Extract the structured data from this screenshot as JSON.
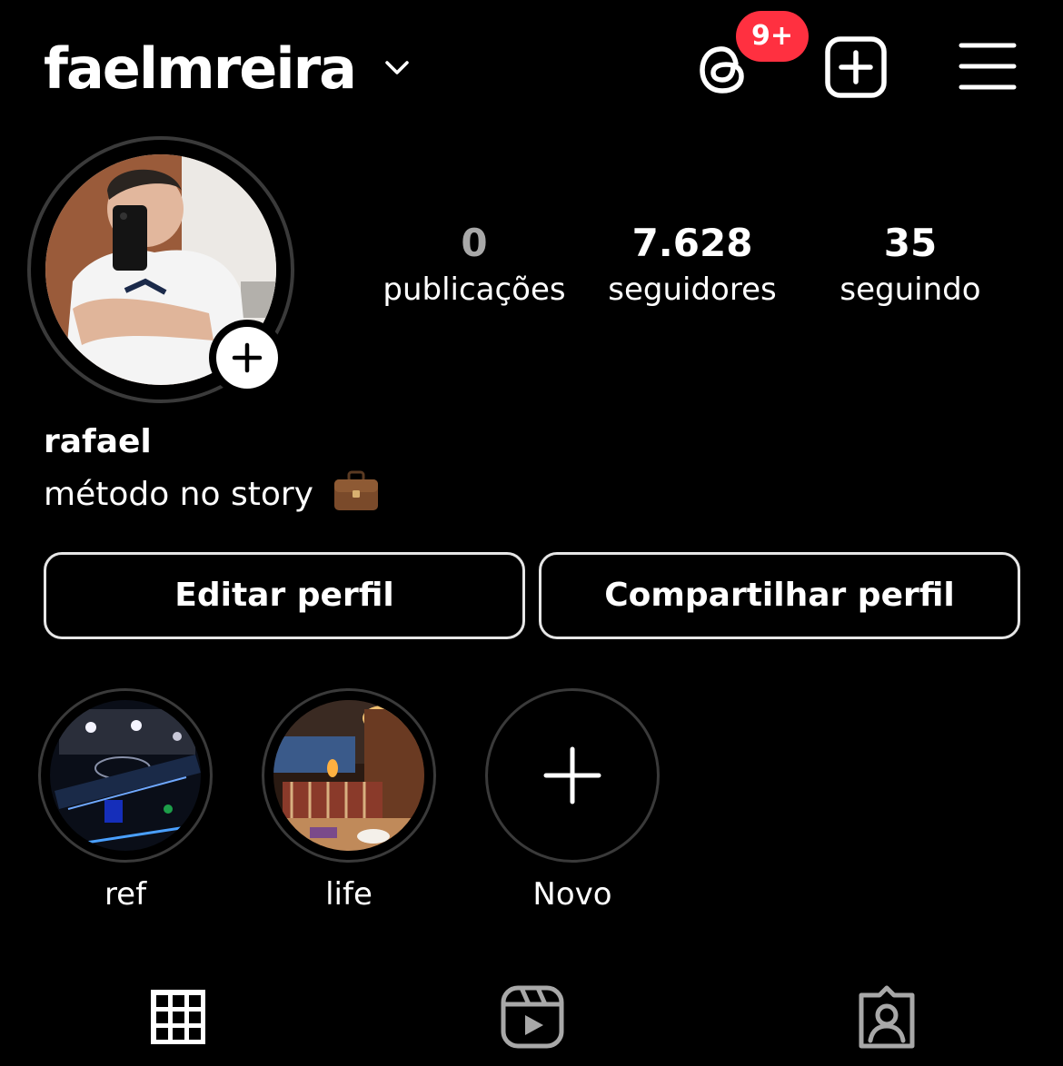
{
  "header": {
    "username": "faelmreira",
    "threads_badge": "9+"
  },
  "profile": {
    "display_name": "rafael",
    "bio": "método no story",
    "bio_emoji": "briefcase-emoji"
  },
  "stats": [
    {
      "value": "0",
      "label": "publicações"
    },
    {
      "value": "7.628",
      "label": "seguidores"
    },
    {
      "value": "35",
      "label": "seguindo"
    }
  ],
  "buttons": {
    "edit": "Editar perfil",
    "share": "Compartilhar perfil"
  },
  "highlights": [
    {
      "label": "ref"
    },
    {
      "label": "life"
    },
    {
      "label": "Novo"
    }
  ],
  "tabs": [
    "grid-icon",
    "reels-icon",
    "tagged-icon"
  ],
  "colors": {
    "background": "#000000",
    "text": "#ffffff",
    "badge": "#ff3040",
    "muted": "#a8a8a8"
  }
}
